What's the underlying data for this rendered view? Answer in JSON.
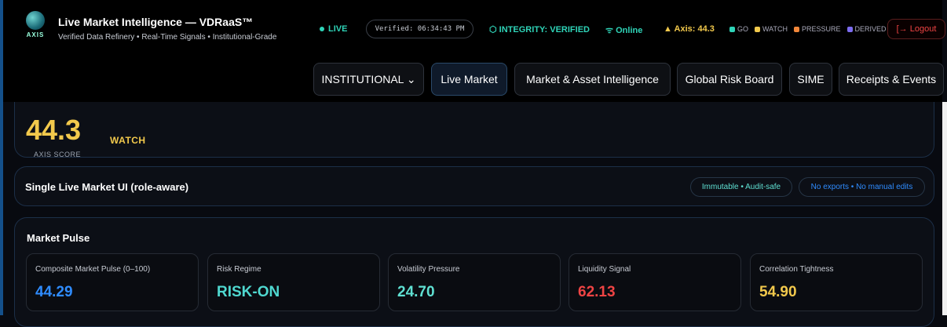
{
  "header": {
    "logo_text": "AXIS",
    "title": "Live Market Intelligence — VDRaaS™",
    "subtitle": "Verified Data Refinery • Real-Time Signals • Institutional-Grade",
    "live": "LIVE",
    "verified": "Verified: 06:34:43 PM",
    "integrity": "INTEGRITY: VERIFIED",
    "online": "Online",
    "axis": "Axis: 44.3",
    "legend": [
      "GO",
      "WATCH",
      "PRESSURE",
      "DERIVED"
    ],
    "logout": "Logout"
  },
  "nav": {
    "role_select": "INSTITUTIONAL",
    "tabs": [
      "Live Market",
      "Market & Asset Intelligence",
      "Global Risk Board",
      "SIME",
      "Receipts & Events"
    ]
  },
  "score": {
    "value": "44.3",
    "label": "AXIS SCORE",
    "status": "WATCH"
  },
  "banner": {
    "title": "Single Live Market UI (role-aware)",
    "pill1": "Immutable • Audit-safe",
    "pill2": "No exports • No manual edits"
  },
  "pulse": {
    "title": "Market Pulse",
    "metrics": [
      {
        "label": "Composite Market Pulse (0–100)",
        "value": "44.29",
        "color": "#2f8cff"
      },
      {
        "label": "Risk Regime",
        "value": "RISK-ON",
        "color": "#4fd8d0"
      },
      {
        "label": "Volatility Pressure",
        "value": "24.70",
        "color": "#5fe0d2"
      },
      {
        "label": "Liquidity Signal",
        "value": "62.13",
        "color": "#ef4444"
      },
      {
        "label": "Correlation Tightness",
        "value": "54.90",
        "color": "#f2c94c"
      }
    ]
  }
}
